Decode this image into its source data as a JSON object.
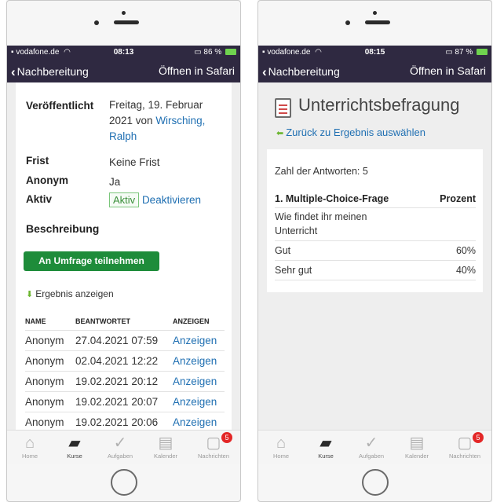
{
  "left": {
    "status": {
      "carrier": "vodafone.de",
      "time": "08:13",
      "battery": "86 %"
    },
    "nav": {
      "back": "Nachbereitung",
      "open": "Öffnen in Safari"
    },
    "details": {
      "published_label": "Veröffentlicht",
      "published_value": "Freitag, 19. Februar 2021 von ",
      "published_author": "Wirsching, Ralph",
      "deadline_label": "Frist",
      "deadline_value": "Keine Frist",
      "anonymous_label": "Anonym",
      "anonymous_value": "Ja",
      "active_label": "Aktiv",
      "active_badge": "Aktiv",
      "deactivate_link": "Deaktivieren",
      "description_label": "Beschreibung"
    },
    "participate_button": "An Umfrage teilnehmen",
    "result_link": "Ergebnis anzeigen",
    "table": {
      "headers": [
        "NAME",
        "BEANTWORTET",
        "ANZEIGEN"
      ],
      "rows": [
        [
          "Anonym",
          "27.04.2021 07:59",
          "Anzeigen"
        ],
        [
          "Anonym",
          "02.04.2021 12:22",
          "Anzeigen"
        ],
        [
          "Anonym",
          "19.02.2021 20:12",
          "Anzeigen"
        ],
        [
          "Anonym",
          "19.02.2021 20:07",
          "Anzeigen"
        ],
        [
          "Anonym",
          "19.02.2021 20:06",
          "Anzeigen"
        ]
      ]
    }
  },
  "right": {
    "status": {
      "carrier": "vodafone.de",
      "time": "08:15",
      "battery": "87 %"
    },
    "nav": {
      "back": "Nachbereitung",
      "open": "Öffnen in Safari"
    },
    "title": "Unterrichtsbefragung",
    "back_link": "Zurück zu Ergebnis auswählen",
    "answers_count": "Zahl der Antworten: 5",
    "question_header": "1. Multiple-Choice-Frage",
    "percent_header": "Prozent",
    "question_text": "Wie findet ihr meinen Unterricht",
    "options": [
      {
        "label": "Gut",
        "percent": "60%"
      },
      {
        "label": "Sehr gut",
        "percent": "40%"
      }
    ]
  },
  "tabbar": {
    "items": [
      "Home",
      "Kurse",
      "Aufgaben",
      "Kalender",
      "Nachrichten"
    ],
    "badge": "5"
  },
  "colors": {
    "statusbar": "#2f2941",
    "accent_link": "#1f6fb2",
    "primary_button": "#1e8c3a",
    "badge_red": "#e32727"
  }
}
